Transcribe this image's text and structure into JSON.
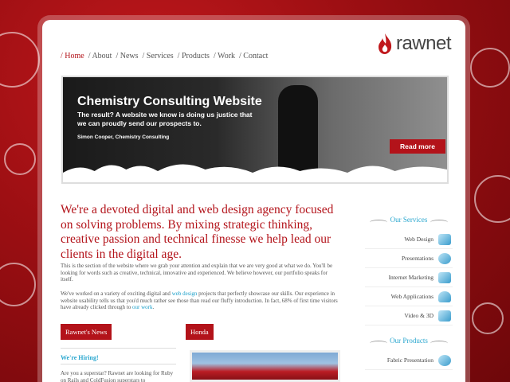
{
  "nav": {
    "items": [
      "/ Home",
      "/ About",
      "/ News",
      "/ Services",
      "/ Products",
      "/ Work",
      "/ Contact"
    ]
  },
  "logo": {
    "word": "rawnet"
  },
  "banner": {
    "title": "Chemistry Consulting Website",
    "subtitle": "The result? A website we know is doing us justice that we can proudly send our prospects to.",
    "cite": "Simon Cooper, Chemistry Consulting",
    "button": "Read more"
  },
  "intro": {
    "headline": "We're a devoted digital and web design agency focused on solving problems. By mixing strategic thinking, creative passion and technical finesse we help lead our clients in the digital age.",
    "para1": "This is the section of the website where we grab your attention and explain that we are very good at what we do. You'll be looking for words such as creative, technical, innovative and experienced. We believe however, our portfolio speaks for itself.",
    "para2_a": "We've worked on a variety of exciting digital and ",
    "para2_link": "web design",
    "para2_b": " projects that perfectly showcase our skills. Our experience in website usability tells us that you'd much rather see those than read our fluffy introduction. In fact, 68% of first time visitors have already clicked through to ",
    "para2_link2": "our work",
    "para2_c": "."
  },
  "sections": {
    "news_tab": "Rawnet's News",
    "honda_tab": "Honda",
    "hiring_title": "We're Hiring!",
    "hiring_text": "Are you a superstar? Rawnet are looking for Ruby on Rails and ColdFusion superstars to"
  },
  "sidebar": {
    "services_title": "Our Services",
    "services": [
      "Web Design",
      "Presentations",
      "Internet Marketing",
      "Web Applications",
      "Video & 3D"
    ],
    "products_title": "Our Products",
    "products": [
      "Fabric Presentation"
    ]
  },
  "colors": {
    "accent": "#b3131a",
    "link": "#2aa7cf",
    "background": "#9e0f13"
  }
}
